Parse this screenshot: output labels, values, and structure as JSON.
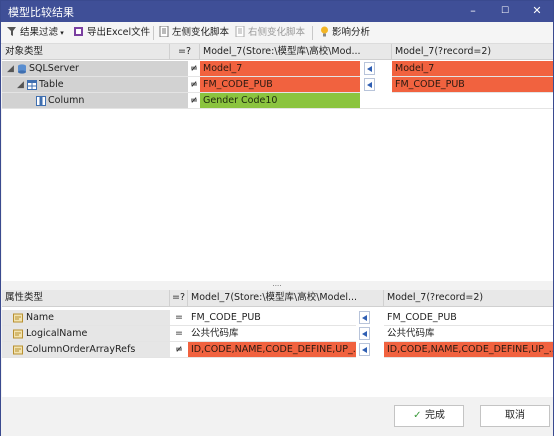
{
  "window": {
    "title": "模型比较结果",
    "minimize": "–",
    "maximize": "☐",
    "close": "✕"
  },
  "toolbar": {
    "filter": "结果过滤",
    "export": "导出Excel文件",
    "left_script": "左侧变化脚本",
    "right_script": "右侧变化脚本",
    "impact": "影响分析"
  },
  "object_grid": {
    "headers": {
      "type": "对象类型",
      "eq": "=?",
      "left": "Model_7(Store:\\模型库\\高校\\Mod...",
      "right": "Model_7(?record=2)"
    },
    "rows": [
      {
        "name": "SQLServer",
        "op": "≠",
        "left": "Model_7",
        "right": "Model_7"
      },
      {
        "name": "Table",
        "op": "≠",
        "left": "FM_CODE_PUB",
        "right": "FM_CODE_PUB"
      },
      {
        "name": "Column",
        "op": "≠",
        "left": "Gender Code10",
        "right": ""
      }
    ]
  },
  "splitter": "....",
  "property_grid": {
    "headers": {
      "type": "属性类型",
      "eq": "=?",
      "left": "Model_7(Store:\\模型库\\高校\\Model...",
      "right": "Model_7(?record=2)"
    },
    "rows": [
      {
        "name": "Name",
        "op": "=",
        "left": "FM_CODE_PUB",
        "right": "FM_CODE_PUB"
      },
      {
        "name": "LogicalName",
        "op": "=",
        "left": "公共代码库",
        "right": "公共代码库"
      },
      {
        "name": "ColumnOrderArrayRefs",
        "op": "≠",
        "left": "ID,CODE,NAME,CODE_DEFINE,UP_...",
        "right": "ID,CODE,NAME,CODE_DEFINE,UP_..."
      }
    ]
  },
  "footer": {
    "ok": "完成",
    "cancel": "取消"
  },
  "colors": {
    "title_bar": "#3f4f97",
    "diff_red": "#f1623f",
    "diff_green": "#8bc43f",
    "accent_blue": "#2f5fb3"
  }
}
